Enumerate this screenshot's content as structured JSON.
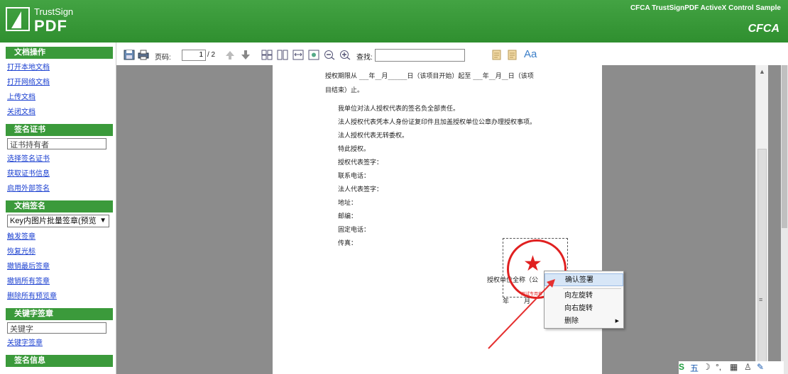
{
  "header": {
    "brand": "TrustSign",
    "product": "PDF",
    "title": "CFCA TrustSignPDF ActiveX Control Sample",
    "cfca": "CFCA"
  },
  "sidebar": {
    "doc_ops": {
      "title": "文档操作",
      "links": [
        "打开本地文档",
        "打开网络文档",
        "上传文档",
        "关闭文档"
      ]
    },
    "cert": {
      "title": "签名证书",
      "input_value": "证书持有者",
      "links": [
        "选择签名证书",
        "获取证书信息",
        "启用外部签名"
      ]
    },
    "doc_sign": {
      "title": "文档签名",
      "select_value": "Key内图片批量签章(预览",
      "links": [
        "触发签章",
        "恢复光标",
        "撤销最后签章",
        "撤销所有签章",
        "删除所有预览章"
      ]
    },
    "keyword_sign": {
      "title": "关键字签章",
      "input_value": "关键字",
      "links": [
        "关键字签章"
      ]
    },
    "sign_info": {
      "title": "签名信息"
    }
  },
  "toolbar": {
    "page_label": "页码:",
    "page_current": "1",
    "page_total": "/ 2",
    "search_label": "查找:",
    "search_value": "",
    "font_label": "Aa"
  },
  "document": {
    "line1": "授权期限从 ___年__月______日（该项目开始）起至 ___年__月__日（该项",
    "line2": "目结束）止。",
    "line3": "我单位对法人授权代表的签名负全部责任。",
    "line4": "法人授权代表凭本人身份证复印件且加盖授权单位公章办理授权事项。",
    "line5": "法人授权代表无转委权。",
    "line6": "特此授权。",
    "line7": "授权代表签字：",
    "line8": "联系电话：",
    "line9": "法人代表签字：",
    "line10": "地址：",
    "line11": "邮编：",
    "line12": "固定电话：",
    "line13": "传真：",
    "line14": "授权单位全称（公",
    "line15": "年",
    "line16": "月",
    "stamp_text": "测试专用章"
  },
  "context_menu": {
    "items": [
      "确认签署",
      "向左旋转",
      "向右旋转",
      "删除"
    ]
  },
  "tray": {
    "ime": "五"
  },
  "colors": {
    "brand_green": "#3b9a3b",
    "stamp_red": "#e02020",
    "link_blue": "#1a3fd0",
    "viewer_gray": "#8c8c8c"
  }
}
